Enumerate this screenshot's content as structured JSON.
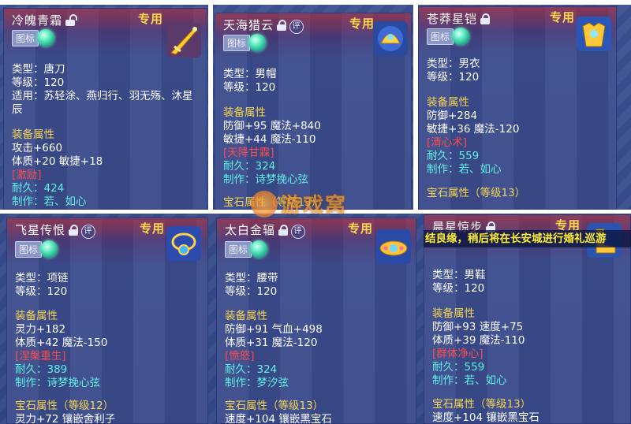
{
  "cards": [
    {
      "name": "冷魄青霜",
      "special": "专用",
      "tag": "图标",
      "icon": "golden-blade-icon",
      "lines": [
        "类型：唐刀",
        "等级：120",
        "适用：苏轻涂、燕归行、羽无殇、沐星辰"
      ],
      "attr_title": "装备属性",
      "attr_lines": [
        "攻击+660",
        "体质+20 敏捷+18"
      ],
      "effect": "[激励]",
      "durability": "耐久：424",
      "maker": "制作：若、如心"
    },
    {
      "name": "天海猎云",
      "special": "专用",
      "tag": "图标",
      "icon": "golden-helm-icon",
      "eval": "评",
      "lines": [
        "类型：男帽",
        "等级：120"
      ],
      "attr_title": "装备属性",
      "attr_lines": [
        "防御+95 魔法+840",
        "敏捷+44 魔法-110"
      ],
      "effect": "[天降甘霖]",
      "durability": "耐久：324",
      "maker": "制作：诗梦挽心弦",
      "gem": "宝石属性（等级13）"
    },
    {
      "name": "苍莽星铠",
      "special": "专用",
      "tag": "图标",
      "icon": "golden-armor-icon",
      "lines": [
        "类型：男衣",
        "等级：120"
      ],
      "attr_title": "装备属性",
      "attr_lines": [
        "防御+284",
        "敏捷+36 魔法-120"
      ],
      "effect": "[清心术]",
      "durability": "耐久：559",
      "maker": "制作：若、如心",
      "gem": "宝石属性（等级13）"
    },
    {
      "name": "飞星传恨",
      "special": "专用",
      "tag": "图标",
      "icon": "blue-necklace-icon",
      "eval": "评",
      "lines": [
        "类型：项链",
        "等级：120"
      ],
      "attr_title": "装备属性",
      "attr_lines": [
        "灵力+182",
        "体质+42 魔法-150"
      ],
      "effect": "[涅槃重生]",
      "durability": "耐久：389",
      "maker": "制作：诗梦挽心弦",
      "gem": "宝石属性（等级12）",
      "gem_line": "灵力+72 镶嵌舍利子"
    },
    {
      "name": "太白金辐",
      "special": "专用",
      "tag": "图标",
      "icon": "jeweled-belt-icon",
      "eval": "评",
      "lines": [
        "类型：腰带",
        "等级：120"
      ],
      "attr_title": "装备属性",
      "attr_lines": [
        "防御+91 气血+498",
        "体质+31 魔法-120"
      ],
      "effect": "[愤怒]",
      "durability": "耐久：324",
      "maker": "制作：梦汐弦",
      "gem": "宝石属性（等级13）",
      "gem_line": "速度+104 镶嵌黑宝石"
    },
    {
      "name": "晨星惊步",
      "special": "专用",
      "tag": "图标",
      "icon": "golden-boots-icon",
      "lines": [
        "类型：男鞋",
        "等级：120"
      ],
      "attr_title": "装备属性",
      "attr_lines": [
        "防御+93 速度+75",
        "体质+39 魔法-110"
      ],
      "effect": "[群体净心]",
      "durability": "耐久：559",
      "maker": "制作：若、如心",
      "gem": "宝石属性（等级13）",
      "gem_line": "速度+104 镶嵌黑宝石"
    }
  ],
  "banner": "结良缘，稍后将在长安城进行婚礼巡游",
  "watermark": "游戏窝"
}
